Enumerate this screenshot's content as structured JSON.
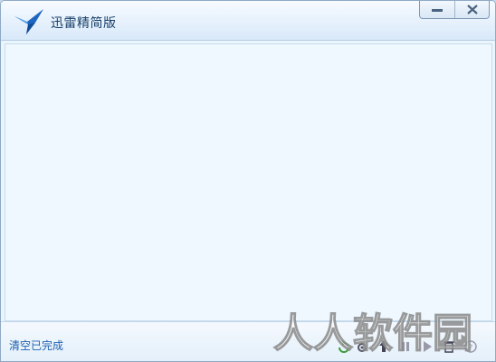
{
  "window": {
    "title": "迅雷精简版"
  },
  "controls": {
    "minimize_icon": "minimize-icon",
    "close_icon": "close-icon"
  },
  "status": {
    "clear_completed": "清空已完成"
  },
  "watermark": {
    "text": "人人软件园"
  },
  "tools": [
    "refresh-icon",
    "settings-icon",
    "up-arrow-icon",
    "pause-icon",
    "start-icon",
    "delete-icon",
    "help-icon"
  ],
  "colors": {
    "accent": "#1d5fb0",
    "title_text": "#173e68",
    "background": "#eaf5fd"
  }
}
